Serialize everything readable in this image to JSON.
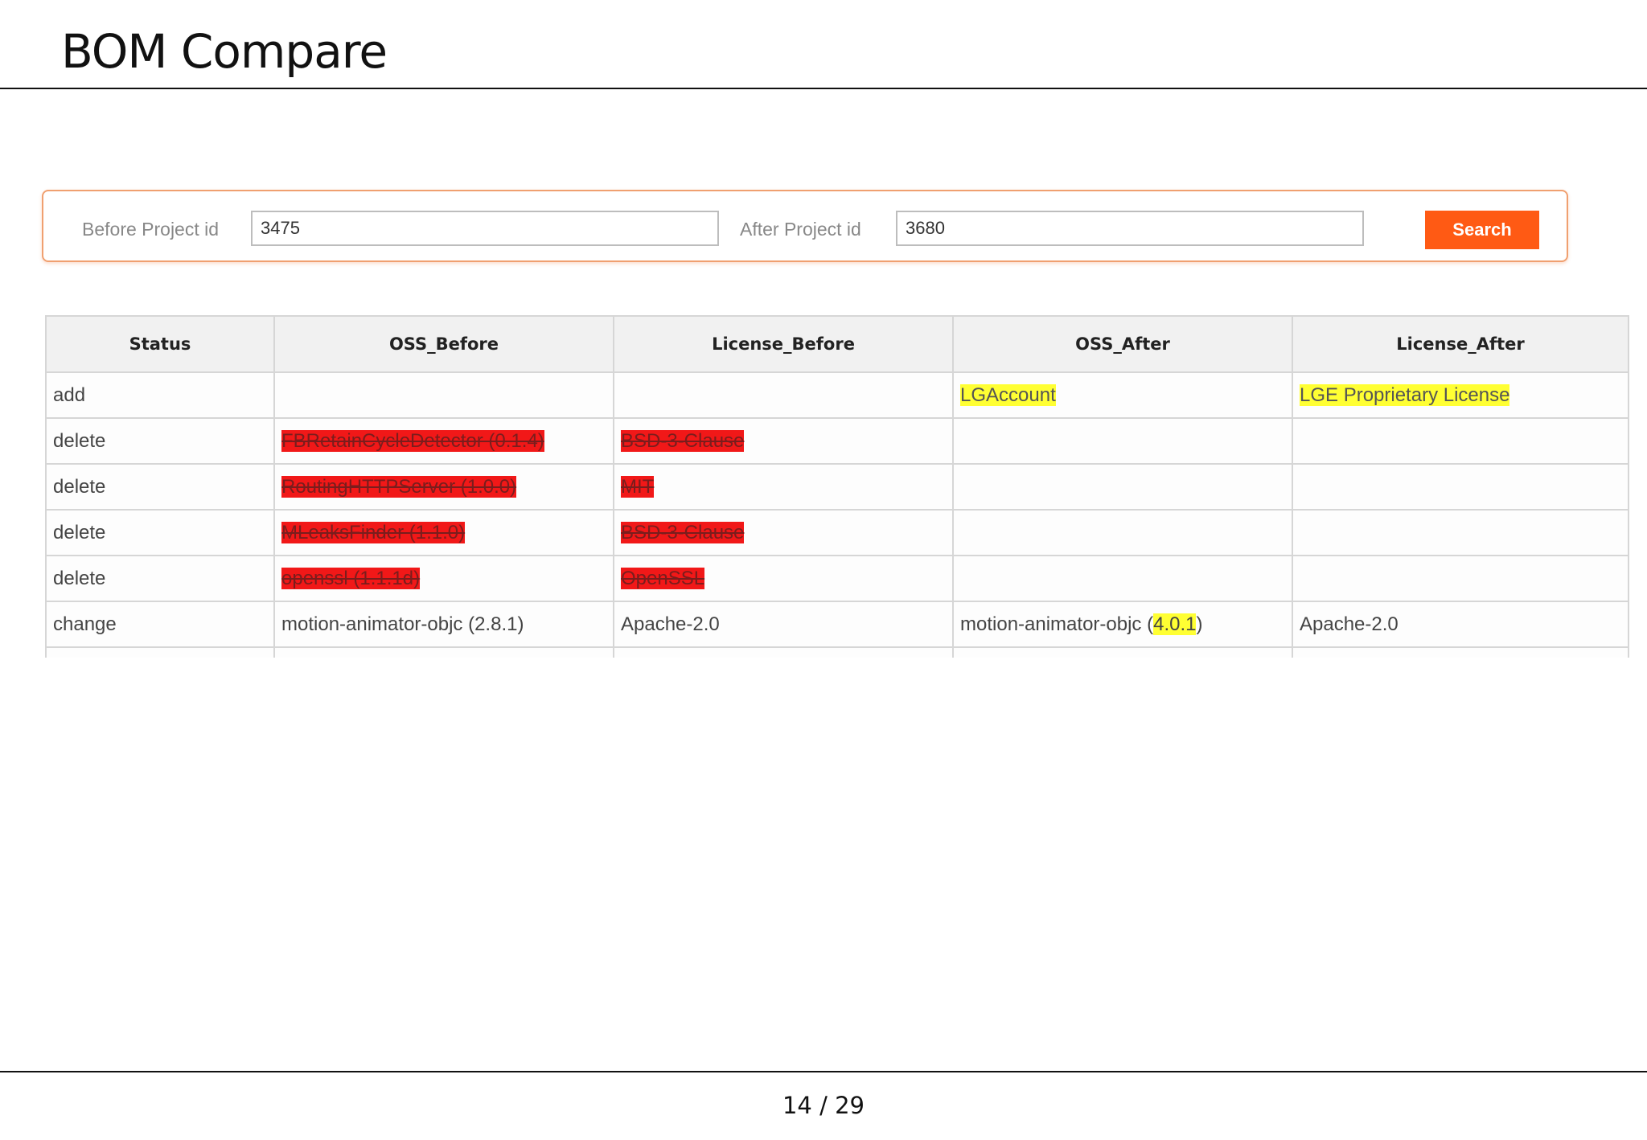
{
  "slide": {
    "title": "BOM Compare",
    "page_number": "14 / 29"
  },
  "search": {
    "before_label": "Before Project id",
    "before_value": "3475",
    "after_label": "After Project id",
    "after_value": "3680",
    "button_label": "Search"
  },
  "colors": {
    "accent": "#ff5a14",
    "added_highlight": "#ffff33",
    "deleted_highlight": "#f11818"
  },
  "table": {
    "headers": [
      "Status",
      "OSS_Before",
      "License_Before",
      "OSS_After",
      "License_After"
    ],
    "rows": [
      {
        "status": "add",
        "oss_before": "",
        "license_before": "",
        "oss_after": "LGAccount",
        "license_after": "LGE Proprietary License"
      },
      {
        "status": "delete",
        "oss_before": "FBRetainCycleDetector (0.1.4)",
        "license_before": "BSD-3-Clause",
        "oss_after": "",
        "license_after": ""
      },
      {
        "status": "delete",
        "oss_before": "RoutingHTTPServer (1.0.0)",
        "license_before": "MIT",
        "oss_after": "",
        "license_after": ""
      },
      {
        "status": "delete",
        "oss_before": "MLeaksFinder (1.1.0)",
        "license_before": "BSD-3-Clause",
        "oss_after": "",
        "license_after": ""
      },
      {
        "status": "delete",
        "oss_before": "openssl (1.1.1d)",
        "license_before": "OpenSSL",
        "oss_after": "",
        "license_after": ""
      },
      {
        "status": "change",
        "oss_before": "motion-animator-objc (2.8.1)",
        "license_before": "Apache-2.0",
        "oss_after_prefix": "motion-animator-objc (",
        "oss_after_version": "4.0.1",
        "oss_after_suffix": ")",
        "license_after": "Apache-2.0"
      }
    ]
  }
}
